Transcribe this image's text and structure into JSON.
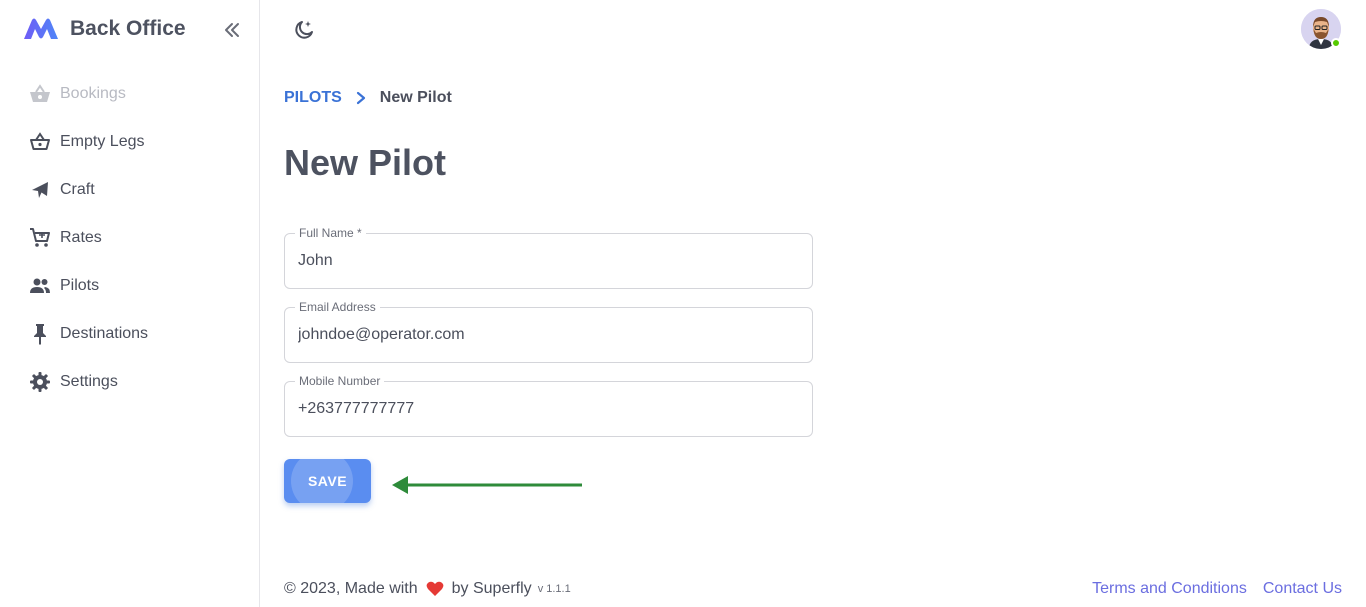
{
  "app": {
    "title": "Back Office"
  },
  "colors": {
    "accent": "#3a72d6",
    "button": "#5a8df0",
    "link": "#6b6ee0",
    "online": "#56ca00",
    "heart": "#e53935",
    "arrow": "#2e8b3a"
  },
  "sidebar": {
    "items": [
      {
        "label": "Bookings",
        "icon": "shopping-basket-icon",
        "disabled": true
      },
      {
        "label": "Empty Legs",
        "icon": "basket-icon"
      },
      {
        "label": "Craft",
        "icon": "airplane-icon"
      },
      {
        "label": "Rates",
        "icon": "cart-icon"
      },
      {
        "label": "Pilots",
        "icon": "people-icon"
      },
      {
        "label": "Destinations",
        "icon": "pin-icon"
      },
      {
        "label": "Settings",
        "icon": "gear-icon"
      }
    ]
  },
  "breadcrumb": {
    "parent": "PILOTS",
    "current": "New Pilot"
  },
  "page": {
    "title": "New Pilot"
  },
  "form": {
    "full_name": {
      "label": "Full Name *",
      "value": "John"
    },
    "email": {
      "label": "Email Address",
      "value": "johndoe@operator.com"
    },
    "mobile": {
      "label": "Mobile Number",
      "value": "+263777777777"
    },
    "save_label": "SAVE"
  },
  "footer": {
    "copyright_prefix": "© 2023, Made with",
    "by": "by Superfly",
    "version": "v 1.1.1",
    "terms": "Terms and Conditions",
    "contact": "Contact Us"
  }
}
